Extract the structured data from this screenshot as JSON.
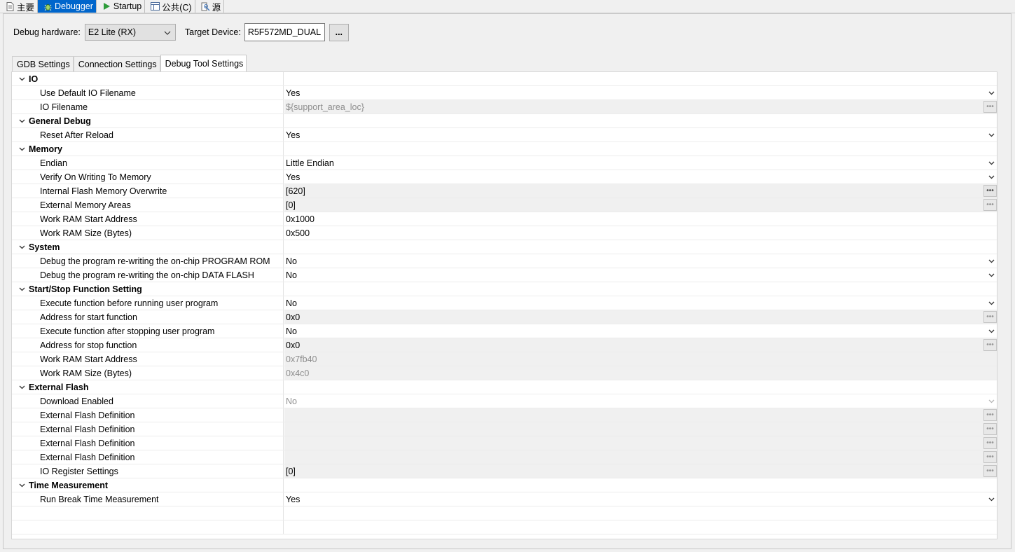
{
  "top_tabs": [
    {
      "label": "主要",
      "icon": "page-icon",
      "active": false
    },
    {
      "label": "Debugger",
      "icon": "debug-bug-icon",
      "active": true
    },
    {
      "label": "Startup",
      "icon": "run-triangle-icon",
      "active": false
    },
    {
      "label": "公共(C)",
      "icon": "table-icon",
      "active": false
    },
    {
      "label": "源",
      "icon": "source-lookup-icon",
      "active": false
    }
  ],
  "hardware": {
    "label": "Debug hardware:",
    "value": "E2 Lite (RX)",
    "target_label": "Target Device:",
    "target_value": "R5F572MD_DUAL",
    "browse_label": "..."
  },
  "inner_tabs": [
    {
      "label": "GDB Settings",
      "active": false
    },
    {
      "label": "Connection Settings",
      "active": false
    },
    {
      "label": "Debug Tool Settings",
      "active": true
    }
  ],
  "categories": [
    {
      "name": "IO",
      "rows": [
        {
          "key": "Use Default IO Filename",
          "value": "Yes",
          "ctl": "dropdown"
        },
        {
          "key": "IO Filename",
          "value": "${support_area_loc}",
          "ctl": "dots-dis",
          "bg": "gray",
          "disabled": true
        }
      ]
    },
    {
      "name": "General Debug",
      "rows": [
        {
          "key": "Reset After Reload",
          "value": "Yes",
          "ctl": "dropdown"
        }
      ]
    },
    {
      "name": "Memory",
      "rows": [
        {
          "key": "Endian",
          "value": "Little Endian",
          "ctl": "dropdown"
        },
        {
          "key": "Verify On Writing To Memory",
          "value": "Yes",
          "ctl": "dropdown"
        },
        {
          "key": "Internal Flash Memory Overwrite",
          "value": "[620]",
          "ctl": "dots",
          "bg": "gray"
        },
        {
          "key": "External Memory Areas",
          "value": "[0]",
          "ctl": "dots-dis",
          "bg": "gray"
        },
        {
          "key": "Work RAM Start Address",
          "value": "0x1000",
          "ctl": "none"
        },
        {
          "key": "Work RAM Size (Bytes)",
          "value": "0x500",
          "ctl": "none"
        }
      ]
    },
    {
      "name": "System",
      "rows": [
        {
          "key": "Debug the program re-writing the on-chip PROGRAM ROM",
          "value": "No",
          "ctl": "dropdown"
        },
        {
          "key": "Debug the program re-writing the on-chip DATA FLASH",
          "value": "No",
          "ctl": "dropdown"
        }
      ]
    },
    {
      "name": "Start/Stop Function Setting",
      "rows": [
        {
          "key": "Execute function before running user program",
          "value": "No",
          "ctl": "dropdown"
        },
        {
          "key": "Address for start function",
          "value": "0x0",
          "ctl": "dots-dis",
          "bg": "gray"
        },
        {
          "key": "Execute function after stopping user program",
          "value": "No",
          "ctl": "dropdown"
        },
        {
          "key": "Address for stop function",
          "value": "0x0",
          "ctl": "dots-dis",
          "bg": "gray"
        },
        {
          "key": "Work RAM Start Address",
          "value": "0x7fb40",
          "ctl": "none",
          "bg": "gray",
          "disabled": true
        },
        {
          "key": "Work RAM Size (Bytes)",
          "value": "0x4c0",
          "ctl": "none",
          "bg": "gray",
          "disabled": true
        }
      ]
    },
    {
      "name": "External Flash",
      "rows": [
        {
          "key": "Download Enabled",
          "value": "No",
          "ctl": "dropdown-dis",
          "disabled": true
        },
        {
          "key": "External Flash Definition",
          "value": "",
          "ctl": "dots-dis",
          "bg": "gray"
        },
        {
          "key": "External Flash Definition",
          "value": "",
          "ctl": "dots-dis",
          "bg": "gray"
        },
        {
          "key": "External Flash Definition",
          "value": "",
          "ctl": "dots-dis",
          "bg": "gray"
        },
        {
          "key": "External Flash Definition",
          "value": "",
          "ctl": "dots-dis",
          "bg": "gray"
        },
        {
          "key": "IO Register Settings",
          "value": "[0]",
          "ctl": "dots-dis",
          "bg": "gray"
        }
      ]
    },
    {
      "name": "Time Measurement",
      "rows": [
        {
          "key": "Run Break Time Measurement",
          "value": "Yes",
          "ctl": "dropdown"
        }
      ]
    }
  ],
  "empty_rows": 2,
  "colors": {
    "accent": "#0066cc",
    "readonly_bg": "#f0f0f0",
    "disabled_text": "#8e8e8e"
  }
}
